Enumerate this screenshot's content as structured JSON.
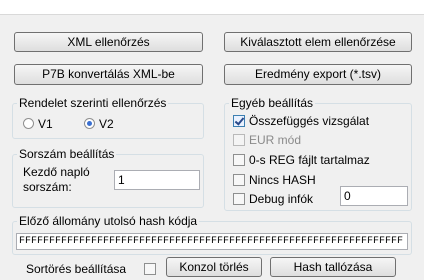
{
  "buttons": {
    "xml_check": "XML ellenőrzés",
    "selected_check": "Kiválasztott elem ellenőrzése",
    "p7b_convert": "P7B konvertálás XML-be",
    "export_result": "Eredmény export (*.tsv)",
    "console_clear": "Konzol törlés",
    "hash_browse": "Hash tallózása"
  },
  "regulation_group": {
    "title": "Rendelet szerinti ellenőrzés",
    "options": [
      {
        "label": "V1",
        "checked": false
      },
      {
        "label": "V2",
        "checked": true
      }
    ]
  },
  "serial_group": {
    "title": "Sorszám beállítás",
    "start_label_1": "Kezdő napló",
    "start_label_2": "sorszám:",
    "start_value": "1"
  },
  "other_group": {
    "title": "Egyéb beállítás",
    "checkboxes": [
      {
        "label": "Összefüggés vizsgálat",
        "checked": true,
        "disabled": false
      },
      {
        "label": "EUR mód",
        "checked": false,
        "disabled": true
      },
      {
        "label": "0-s REG fájlt tartalmaz",
        "checked": false,
        "disabled": false
      },
      {
        "label": "Nincs HASH",
        "checked": false,
        "disabled": false
      },
      {
        "label": "Debug infók",
        "checked": false,
        "disabled": false
      }
    ],
    "debug_value": "0"
  },
  "hash_group": {
    "title": "Előző állomány utolsó hash kódja",
    "value": "FFFFFFFFFFFFFFFFFFFFFFFFFFFFFFFFFFFFFFFFFFFFFFFFFFFFFFFFFFFFFFFF"
  },
  "line_break_label": "Sortörés beállítása"
}
